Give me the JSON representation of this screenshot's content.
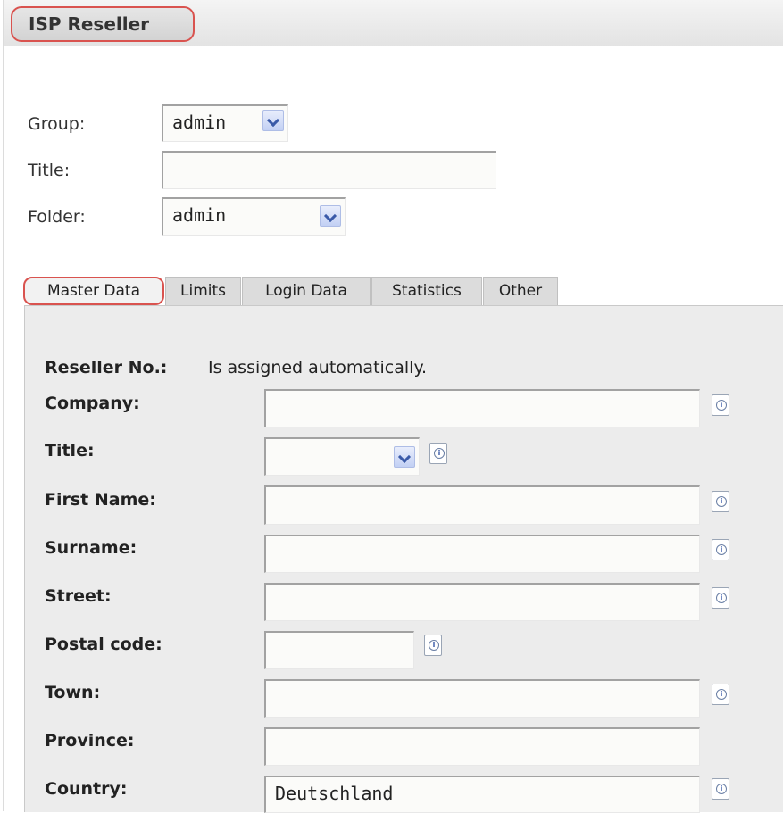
{
  "window": {
    "title": "ISP Reseller"
  },
  "header": {
    "group_label": "Group:",
    "group_value": "admin",
    "title_label": "Title:",
    "title_value": "",
    "folder_label": "Folder:",
    "folder_value": "admin"
  },
  "tabs": [
    {
      "label": "Master Data",
      "active": true
    },
    {
      "label": "Limits",
      "active": false
    },
    {
      "label": "Login Data",
      "active": false
    },
    {
      "label": "Statistics",
      "active": false
    },
    {
      "label": "Other",
      "active": false
    }
  ],
  "master_data": {
    "reseller_no_label": "Reseller No.:",
    "reseller_no_value": "Is assigned automatically.",
    "company_label": "Company:",
    "company_value": "",
    "title_label": "Title:",
    "title_value": "",
    "first_name_label": "First Name:",
    "first_name_value": "",
    "surname_label": "Surname:",
    "surname_value": "",
    "street_label": "Street:",
    "street_value": "",
    "postal_code_label": "Postal code:",
    "postal_code_value": "",
    "town_label": "Town:",
    "town_value": "",
    "province_label": "Province:",
    "province_value": "",
    "country_label": "Country:",
    "country_value": "Deutschland"
  },
  "icons": {
    "dropdown": "chevron-down-icon",
    "info": "info-icon"
  },
  "colors": {
    "highlight": "#d9534f",
    "panel_bg": "#ececec",
    "dropdown_accent": "#3a5aa8"
  }
}
